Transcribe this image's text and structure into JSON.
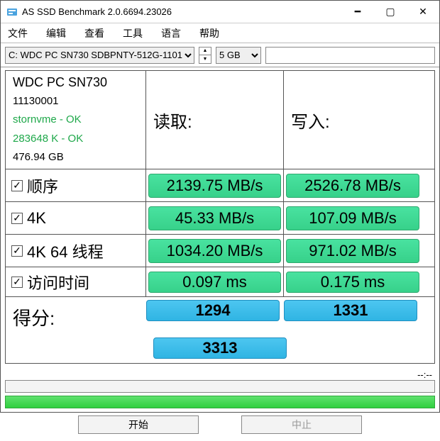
{
  "window": {
    "title": "AS SSD Benchmark 2.0.6694.23026"
  },
  "menu": {
    "file": "文件",
    "edit": "编辑",
    "view": "查看",
    "tools": "工具",
    "lang": "语言",
    "help": "帮助"
  },
  "toolbar": {
    "drive_selected": "C: WDC PC SN730 SDBPNTY-512G-1101",
    "size_selected": "5 GB",
    "extra_value": ""
  },
  "drive": {
    "name": "WDC PC SN730",
    "id": "11130001",
    "driver": "stornvme - OK",
    "align": "283648 K - OK",
    "capacity": "476.94 GB"
  },
  "headers": {
    "read": "读取:",
    "write": "写入:"
  },
  "tests": {
    "seq": {
      "label": "顺序",
      "read": "2139.75 MB/s",
      "write": "2526.78 MB/s"
    },
    "k4": {
      "label": "4K",
      "read": "45.33 MB/s",
      "write": "107.09 MB/s"
    },
    "k464": {
      "label": "4K 64 线程",
      "read": "1034.20 MB/s",
      "write": "971.02 MB/s"
    },
    "acc": {
      "label": "访问时间",
      "read": "0.097 ms",
      "write": "0.175 ms"
    }
  },
  "score": {
    "label": "得分:",
    "read": "1294",
    "write": "1331",
    "total": "3313"
  },
  "time": "--:--",
  "buttons": {
    "start": "开始",
    "stop": "中止"
  }
}
